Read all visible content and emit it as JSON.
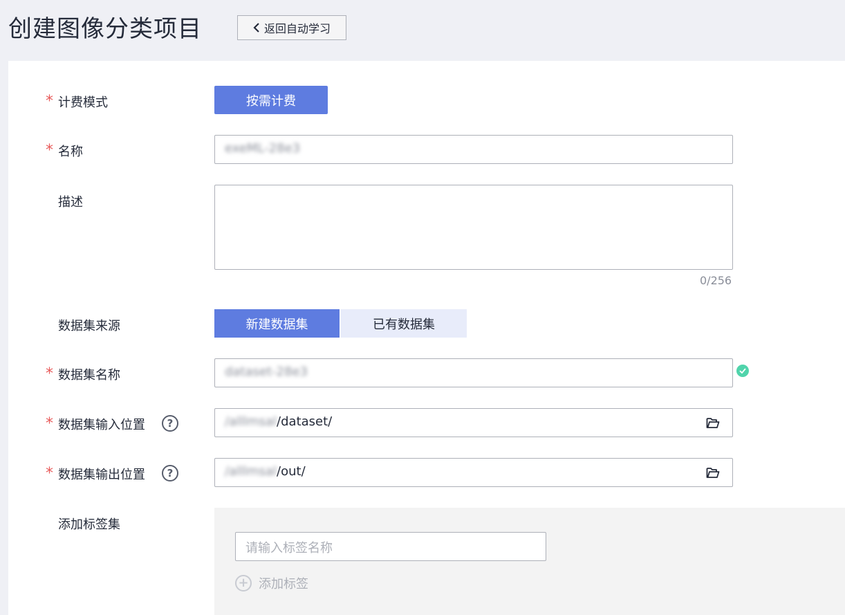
{
  "header": {
    "title": "创建图像分类项目",
    "back_label": "返回自动学习"
  },
  "form": {
    "billing": {
      "label": "计费模式",
      "required": "*",
      "value": "按需计费"
    },
    "name": {
      "label": "名称",
      "required": "*",
      "value": "exeML-28e3"
    },
    "description": {
      "label": "描述",
      "value": "",
      "counter": "0/256"
    },
    "dataset_source": {
      "label": "数据集来源",
      "options": [
        "新建数据集",
        "已有数据集"
      ],
      "selected": "新建数据集"
    },
    "dataset_name": {
      "label": "数据集名称",
      "required": "*",
      "value": "dataset-28e3"
    },
    "dataset_input": {
      "label": "数据集输入位置",
      "required": "*",
      "prefix": "/alllmsal",
      "suffix": "/dataset/"
    },
    "dataset_output": {
      "label": "数据集输出位置",
      "required": "*",
      "prefix": "/alllmsal",
      "suffix": "/out/"
    },
    "label_set": {
      "label": "添加标签集",
      "placeholder": "请输入标签名称",
      "add_label": "添加标签"
    }
  },
  "colors": {
    "accent": "#5e7ce0",
    "required": "#e85a5a",
    "success": "#50d4ab",
    "page_bg": "#eff0f5"
  },
  "icons": [
    "chevron-left-icon",
    "help-icon",
    "check-circle-icon",
    "folder-open-icon",
    "plus-circle-icon"
  ]
}
